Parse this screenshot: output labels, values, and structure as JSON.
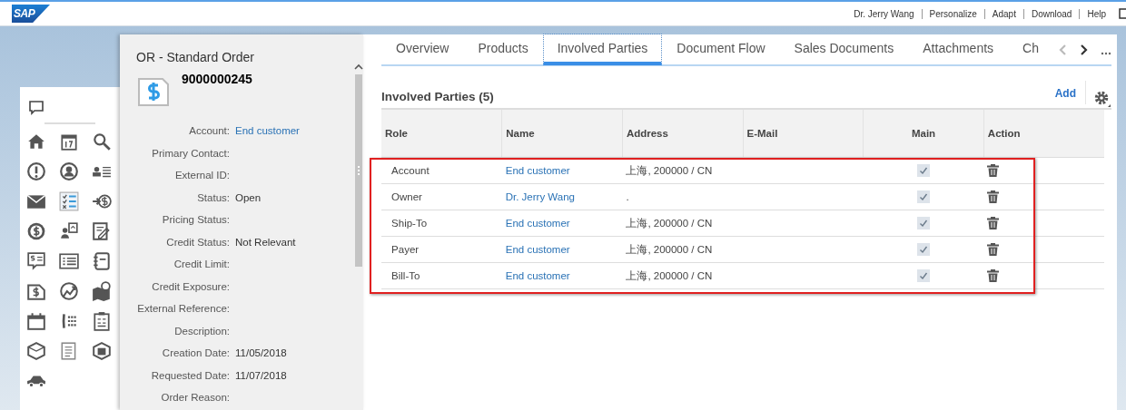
{
  "header": {
    "logo": "SAP",
    "links": [
      "Dr. Jerry Wang",
      "Personalize",
      "Adapt",
      "Download",
      "Help"
    ]
  },
  "detail": {
    "title": "OR - Standard Order",
    "number": "9000000245",
    "fields": [
      {
        "label": "Account:",
        "value": "End customer",
        "kind": "link"
      },
      {
        "label": "Primary Contact:"
      },
      {
        "label": "External ID:"
      },
      {
        "label": "Status:",
        "value": "Open",
        "kind": "text"
      },
      {
        "label": "Pricing Status:"
      },
      {
        "label": "Credit Status:",
        "value": "Not Relevant",
        "kind": "text"
      },
      {
        "label": "Credit Limit:"
      },
      {
        "label": "Credit Exposure:"
      },
      {
        "label": "External Reference:"
      },
      {
        "label": "Description:"
      },
      {
        "label": "Creation Date:",
        "value": "11/05/2018",
        "kind": "text"
      },
      {
        "label": "Requested Date:",
        "value": "11/07/2018",
        "kind": "text"
      },
      {
        "label": "Order Reason:"
      }
    ]
  },
  "tabs": [
    {
      "label": "Overview",
      "selected": false
    },
    {
      "label": "Products",
      "selected": false
    },
    {
      "label": "Involved Parties",
      "selected": true
    },
    {
      "label": "Document Flow",
      "selected": false
    },
    {
      "label": "Sales Documents",
      "selected": false
    },
    {
      "label": "Attachments",
      "selected": false
    },
    {
      "label": "Ch",
      "selected": false
    }
  ],
  "tab_scroll": {
    "back_disabled": true,
    "forward_disabled": false
  },
  "section": {
    "title": "Involved Parties (5)",
    "add": "Add"
  },
  "table": {
    "columns": [
      "Role",
      "Name",
      "Address",
      "E-Mail",
      "Main",
      "Action"
    ],
    "rows": [
      {
        "role": "Account",
        "name": "End customer",
        "address": "上海, 200000 / CN",
        "main": true
      },
      {
        "role": "Owner",
        "name": "Dr. Jerry Wang",
        "address": ".",
        "main": true
      },
      {
        "role": "Ship-To",
        "name": "End customer",
        "address": "上海, 200000 / CN",
        "main": true
      },
      {
        "role": "Payer",
        "name": "End customer",
        "address": "上海, 200000 / CN",
        "main": true
      },
      {
        "role": "Bill-To",
        "name": "End customer",
        "address": "上海, 200000 / CN",
        "main": true
      }
    ]
  },
  "highlight": {
    "shown": true
  }
}
